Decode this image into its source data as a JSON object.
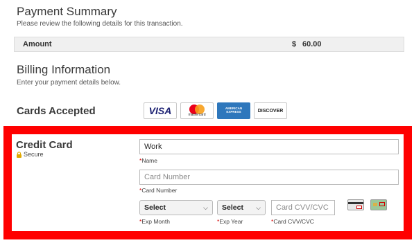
{
  "payment_summary": {
    "title": "Payment Summary",
    "subtitle": "Please review the following details for this transaction."
  },
  "amount": {
    "label": "Amount",
    "currency": "$",
    "value": "60.00"
  },
  "billing": {
    "title": "Billing Information",
    "subtitle": "Enter your payment details below."
  },
  "cards_accepted": {
    "label": "Cards Accepted",
    "logos": [
      {
        "name": "visa-logo",
        "text": "VISA"
      },
      {
        "name": "mastercard-logo",
        "text": "mastercard"
      },
      {
        "name": "amex-logo",
        "text": "AMERICAN EXPRESS"
      },
      {
        "name": "discover-logo",
        "text": "DISCOVER"
      }
    ]
  },
  "credit_card": {
    "title": "Credit Card",
    "secure_label": "Secure",
    "name_field": {
      "value": "Work",
      "label": "Name",
      "required_mark": "*"
    },
    "number_field": {
      "placeholder": "Card Number",
      "label": "Card Number",
      "required_mark": "*"
    },
    "exp_month": {
      "selected": "Select",
      "label": "Exp Month",
      "required_mark": "*"
    },
    "exp_year": {
      "selected": "Select",
      "label": "Exp Year",
      "required_mark": "*"
    },
    "cvv_field": {
      "placeholder": "Card CVV/CVC",
      "label": "Card CVV/CVC",
      "required_mark": "*"
    }
  },
  "colors": {
    "highlight_border": "#ff0000",
    "required": "#d60000",
    "amex_blue": "#2e77bc",
    "visa_blue": "#1a1f71"
  }
}
